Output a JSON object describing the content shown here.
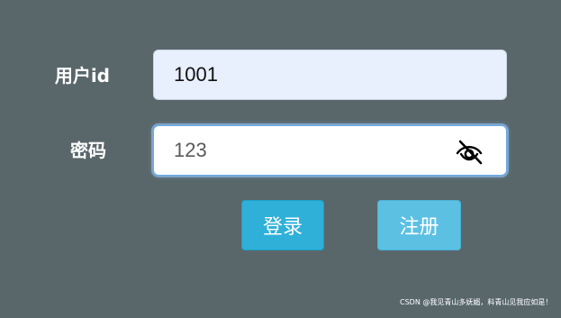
{
  "form": {
    "userid_label": "用户id",
    "userid_value": "1001",
    "password_label": "密码",
    "password_value": "123",
    "password_toggle_icon": "eye-slash-icon"
  },
  "buttons": {
    "login_label": "登录",
    "register_label": "注册"
  },
  "watermark": {
    "text": "CSDN @我见青山多妩媚，料青山见我应如是！"
  },
  "colors": {
    "background": "#59676b",
    "login_button": "#2fb0d8",
    "register_button": "#5cc0e3",
    "userid_input_background": "#e8effd",
    "password_focus_border": "#66a9e8"
  }
}
